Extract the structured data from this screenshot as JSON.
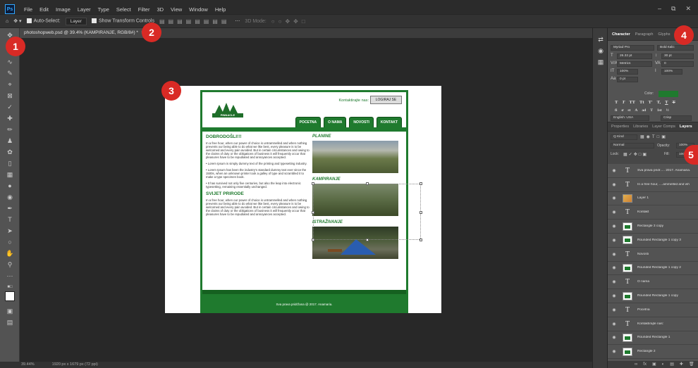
{
  "menubar": {
    "logo": "Ps",
    "items": [
      "File",
      "Edit",
      "Image",
      "Layer",
      "Type",
      "Select",
      "Filter",
      "3D",
      "View",
      "Window",
      "Help"
    ],
    "window_controls": [
      "–",
      "⧉",
      "✕"
    ]
  },
  "options": {
    "home_icon": "home-icon",
    "auto_select": "Auto-Select:",
    "layer_dropdown": "Layer",
    "show_transform": "Show Transform Controls",
    "three_d_mode": "3D Mode:"
  },
  "document_tab": {
    "title": "photoshopweb.psd @ 39.4% (KAMPIRANJE, RGB/8#) *",
    "close": "×"
  },
  "website": {
    "contact_label": "Kontaktirajte nas:",
    "login_button": "LOGIRAJ SE",
    "logo_text": "PINNACLE",
    "nav": [
      "POCETNA",
      "O NAMA",
      "NOVOSTI",
      "KONTAKT"
    ],
    "welcome_heading": "DOBRODOŠLI!!!",
    "welcome_text": "In a free hour, when our power of choice is untrammelled and when nothing prevents our being able to do what we like best, every pleasure is to be welcomed and every pain avoided. But in certain circumstances and owing to the claims of duty or the obligations of business it will frequently occur that pleasures have to be repudiated and annoyances accepted.",
    "bullet_1": "• Lorem Ipsum is simply dummy text of the printing and typesetting industry.",
    "bullet_2": "• Lorem Ipsum has been the industry's standard dummy text ever since the 1500s, when an unknown printer took a galley of type and scrambled it to make a type specimen book.",
    "bullet_3": "• It has survived not only five centuries, but also the leap into electronic typesetting, remaining essentially unchanged.",
    "nature_heading": "SVIJET PRIRODE",
    "nature_text": "In a free hour, when our power of choice is untrammelled and when nothing prevents our being able to do what we like best, every pleasure is to be welcomed and every pain avoided. But in certain circumstances and owing to the claims of duty or the obligations of business it will frequently occur that pleasures have to be repudiated and annoyances accepted.",
    "section_plains": "PLANINE",
    "section_camping": "KAMPIRANJE",
    "section_explore": "ISTRAŽIVANJE",
    "footer": "Sva prava pridržana @ 2017. Anamaria."
  },
  "badges": [
    "1",
    "2",
    "3",
    "4",
    "5"
  ],
  "status_bar": {
    "zoom": "39.44%",
    "doc_info": "1920 px x 1679 px (72 ppi)"
  },
  "panels": {
    "top_tabs": [
      "Character",
      "Paragraph",
      "Glyphs"
    ],
    "character": {
      "font_family": "Myriad Pro",
      "font_style": "Bold Italic",
      "font_size": "26.32 pt",
      "leading": "30 pt",
      "kerning": "Metrics",
      "tracking": "0",
      "vertical_scale": "100%",
      "horizontal_scale": "100%",
      "baseline_shift": "0 pt",
      "color_label": "Color:",
      "style_buttons": [
        "T",
        "T",
        "TT",
        "Tt",
        "T'",
        "T,",
        "T",
        "T"
      ],
      "opentype_buttons": [
        "fi",
        "ơ",
        "st",
        "A",
        "ad",
        "T",
        "1st",
        "½"
      ],
      "language": "English: USA",
      "antialias": "Crisp"
    },
    "layers_tabs": [
      "Properties",
      "Libraries",
      "Layer Comps",
      "Layers"
    ],
    "layers_controls": {
      "kind": "Q Kind",
      "blend_mode": "Normal",
      "opacity_label": "Opacity:",
      "opacity": "100%",
      "lock_label": "Lock:",
      "fill_label": "Fill:",
      "fill": "100%"
    },
    "layers": [
      {
        "type": "text",
        "name": "Sva prava pridr..... 2017. Anamaria."
      },
      {
        "type": "text",
        "name": "In a free hour, ....ammelled and wh"
      },
      {
        "type": "photo",
        "name": "Layer 1"
      },
      {
        "type": "text",
        "name": "Kontakt"
      },
      {
        "type": "shape",
        "name": "Rectangle 3 copy"
      },
      {
        "type": "shape",
        "name": "Rounded Rectangle 1 copy 3"
      },
      {
        "type": "text",
        "name": "Novosti"
      },
      {
        "type": "shape",
        "name": "Rounded Rectangle 1 copy 2"
      },
      {
        "type": "text",
        "name": "O nama"
      },
      {
        "type": "shape",
        "name": "Rounded Rectangle 1 copy"
      },
      {
        "type": "text",
        "name": "Pocetna"
      },
      {
        "type": "text",
        "name": "Kontaktirajte nas:"
      },
      {
        "type": "shape",
        "name": "Rounded Rectangle 1"
      },
      {
        "type": "shape",
        "name": "Rectangle 2"
      },
      {
        "type": "shape",
        "name": "Rectangle 2"
      }
    ]
  },
  "colors": {
    "accent_green": "#1f7a2e",
    "badge_red": "#d92a25"
  }
}
